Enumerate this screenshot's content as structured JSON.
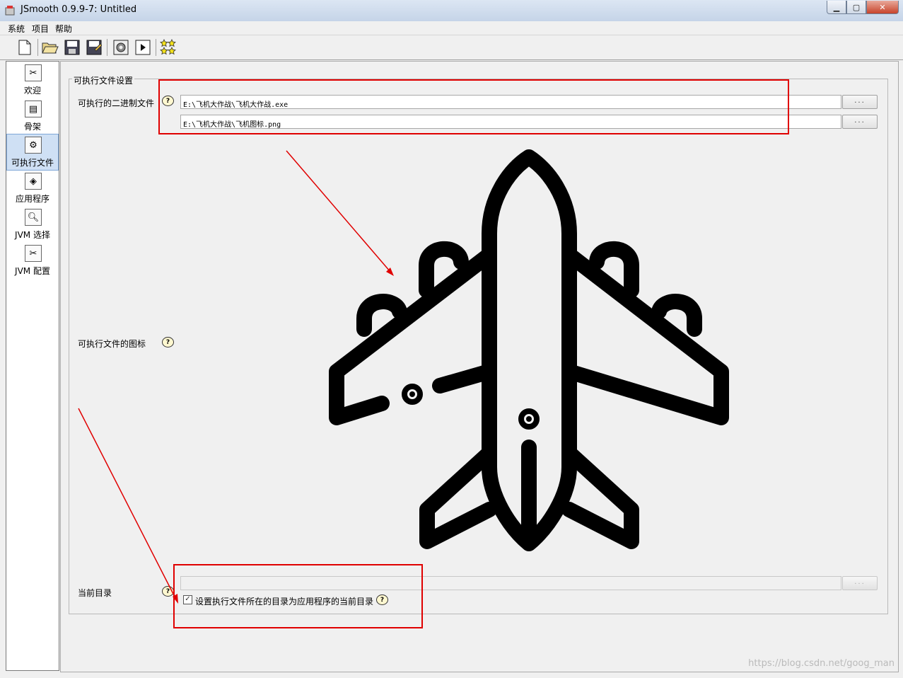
{
  "window": {
    "title": "JSmooth 0.9.9-7: Untitled"
  },
  "menu": [
    "系统",
    "项目",
    "帮助"
  ],
  "toolbar": {
    "icons": [
      "new-file-icon",
      "open-folder-icon",
      "save-icon",
      "save-as-icon",
      "compile-icon",
      "run-icon",
      "stars-icon"
    ]
  },
  "sidebar": {
    "items": [
      {
        "label": "欢迎",
        "icon": "welcome-icon"
      },
      {
        "label": "骨架",
        "icon": "skeleton-icon"
      },
      {
        "label": "可执行文件",
        "icon": "executable-icon",
        "selected": true
      },
      {
        "label": "应用程序",
        "icon": "application-icon"
      },
      {
        "label": "JVM 选择",
        "icon": "jvm-select-icon"
      },
      {
        "label": "JVM 配置",
        "icon": "jvm-config-icon"
      }
    ]
  },
  "panel": {
    "group_title": "可执行文件设置",
    "binary_label": "可执行的二进制文件",
    "binary_value": "E:\\飞机大作战\\飞机大作战.exe",
    "icon_path_value": "E:\\飞机大作战\\飞机图标.png",
    "icon_label": "可执行文件的图标",
    "current_dir_label": "当前目录",
    "current_dir_value": "",
    "checkbox_label": "设置执行文件所在的目录为应用程序的当前目录",
    "checkbox_checked": true,
    "browse_label": "...",
    "help_glyph": "?"
  },
  "watermark": "https://blog.csdn.net/goog_man",
  "colors": {
    "annotation": "#e00000",
    "selection": "#cfe0f4"
  }
}
